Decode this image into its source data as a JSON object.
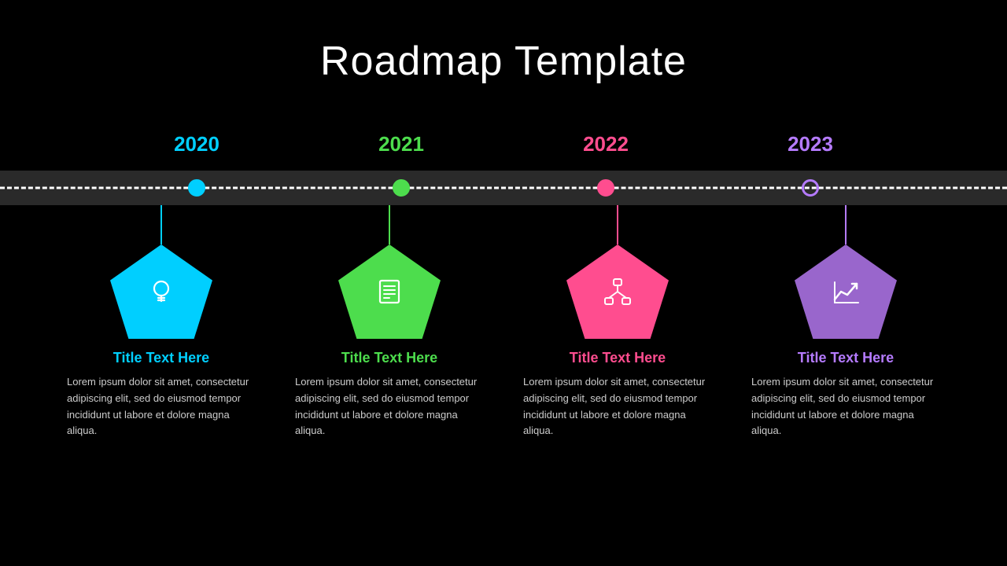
{
  "page": {
    "title": "Roadmap Template",
    "background": "#000000"
  },
  "timeline": {
    "years": [
      {
        "id": "2020",
        "label": "2020",
        "color": "#00cfff",
        "dot_class": "dot-2020",
        "connector_class": "connector-2020",
        "pentagon_class": "pentagon-2020",
        "title_class": "title-2020",
        "year_class": "year-2020",
        "icon": "lightbulb",
        "title": "Title Text Here",
        "description": "Lorem ipsum dolor sit amet, consectetur adipiscing elit, sed do eiusmod tempor incididunt ut labore et dolore magna aliqua."
      },
      {
        "id": "2021",
        "label": "2021",
        "color": "#4ddd4d",
        "dot_class": "dot-2021",
        "connector_class": "connector-2021",
        "pentagon_class": "pentagon-2021",
        "title_class": "title-2021",
        "year_class": "year-2021",
        "icon": "list",
        "title": "Title Text Here",
        "description": "Lorem ipsum dolor sit amet, consectetur adipiscing elit, sed do eiusmod tempor incididunt ut labore et dolore magna aliqua."
      },
      {
        "id": "2022",
        "label": "2022",
        "color": "#ff4d8f",
        "dot_class": "dot-2022",
        "connector_class": "connector-2022",
        "pentagon_class": "pentagon-2022",
        "title_class": "title-2022",
        "year_class": "year-2022",
        "icon": "network",
        "title": "Title Text Here",
        "description": "Lorem ipsum dolor sit amet, consectetur adipiscing elit, sed do eiusmod tempor incididunt ut labore et dolore magna aliqua."
      },
      {
        "id": "2023",
        "label": "2023",
        "color": "#b57bff",
        "dot_class": "dot-2023",
        "connector_class": "connector-2023",
        "pentagon_class": "pentagon-2023",
        "title_class": "title-2023",
        "year_class": "year-2023",
        "icon": "chart",
        "title": "Title Text Here",
        "description": "Lorem ipsum dolor sit amet, consectetur adipiscing elit, sed do eiusmod tempor incididunt ut labore et dolore magna aliqua."
      }
    ]
  }
}
